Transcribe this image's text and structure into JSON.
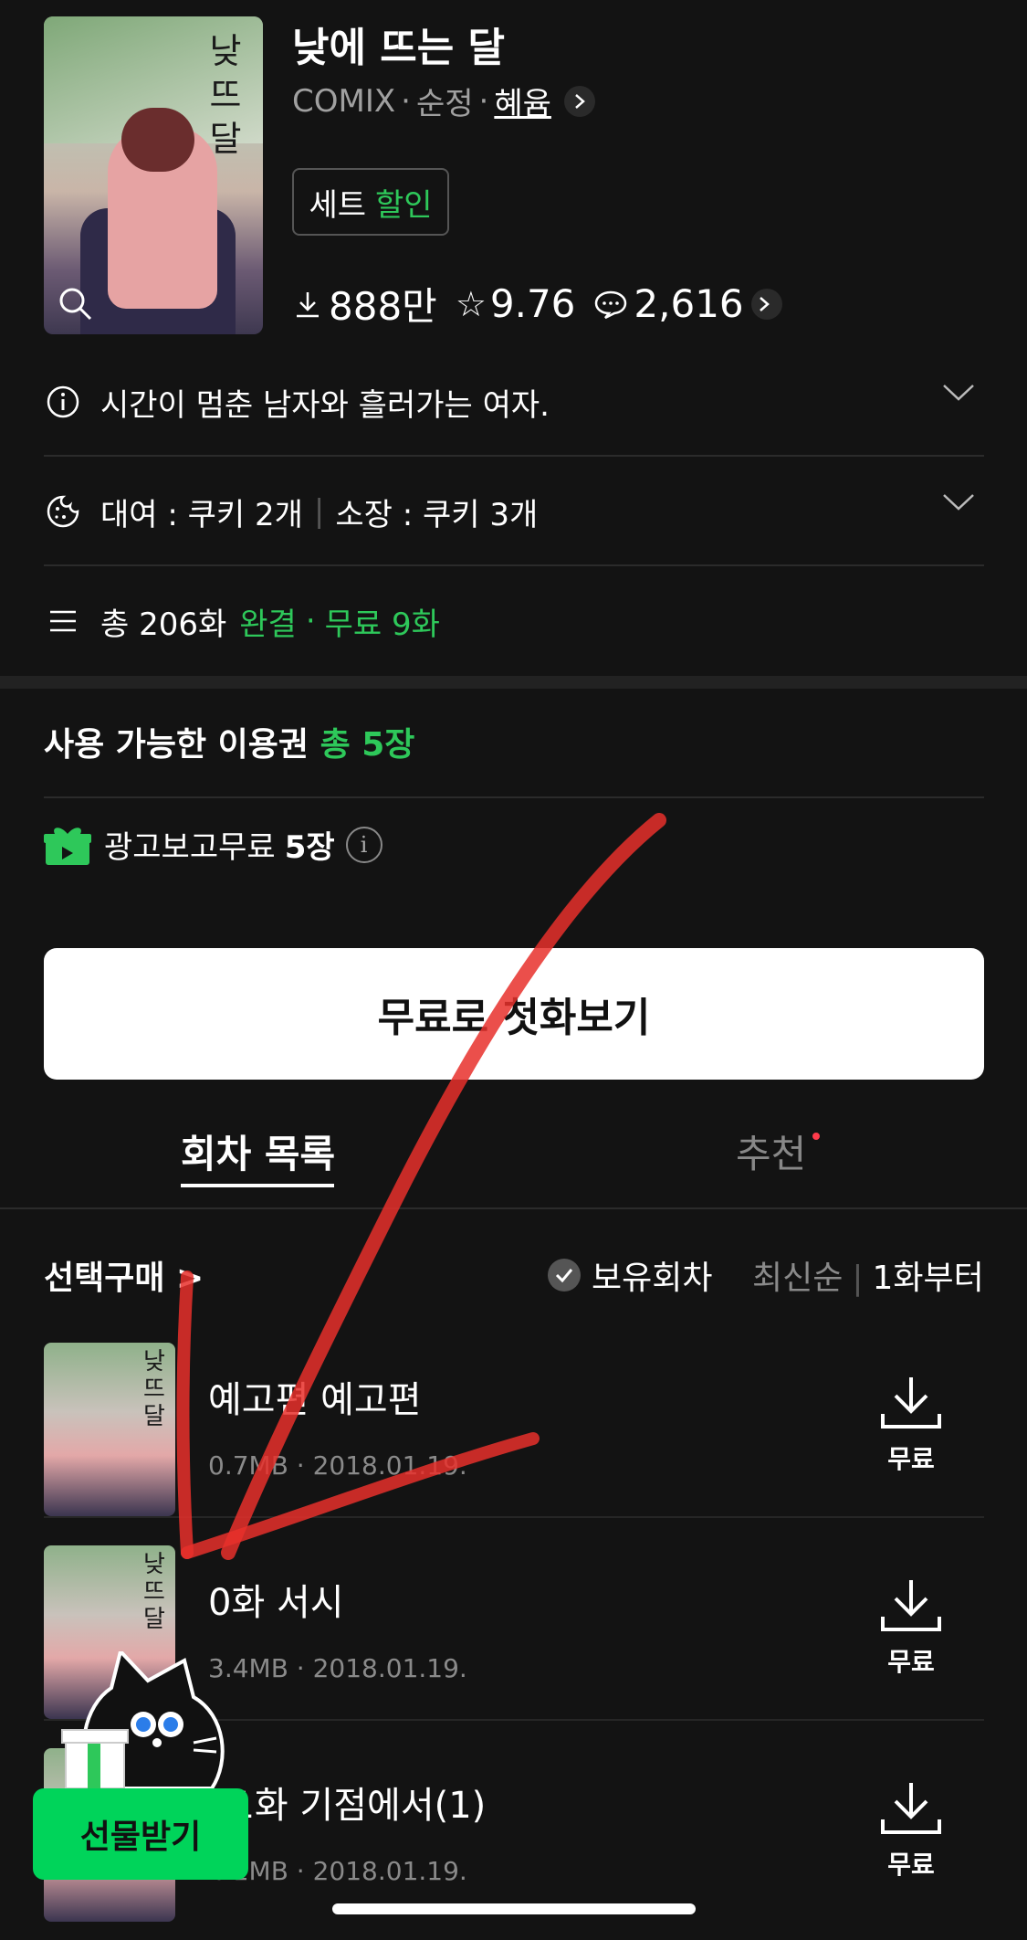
{
  "header": {
    "title": "낮에 뜨는 달",
    "publisher": "COMIX",
    "genre": "순정",
    "author": "혜윰",
    "set_label": "세트",
    "set_discount": "할인",
    "downloads": "888만",
    "rating": "9.76",
    "comments": "2,616",
    "cover_art_text": "낮에뜨는달"
  },
  "info": {
    "synopsis": "시간이 멈춘 남자와 흘러가는 여자.",
    "rent": "대여 : 쿠키 2개",
    "own": "소장 : 쿠키 3개",
    "total": "총 206화",
    "status": "완결",
    "free": "무료 9화",
    "dot": "·"
  },
  "tickets": {
    "title": "사용 가능한 이용권",
    "count": "총 5장",
    "ad_label": "광고보고무료",
    "ad_count": "5장"
  },
  "cta": {
    "free_first": "무료로 첫화보기"
  },
  "tabs": {
    "episodes": "회차 목록",
    "recommend": "추천"
  },
  "list_header": {
    "select_buy": "선택구매 >",
    "owned": "보유회차",
    "sort_latest": "최신순",
    "sort_first": "1화부터"
  },
  "episodes": [
    {
      "title": "예고편 예고편",
      "meta": "0.7MB · 2018.01.19.",
      "action": "무료"
    },
    {
      "title": "0화 서시",
      "meta": "3.4MB · 2018.01.19.",
      "action": "무료"
    },
    {
      "title": "01화 기점에서(1)",
      "meta": "4.1MB · 2018.01.19.",
      "action": "무료"
    }
  ],
  "gift": {
    "label": "선물받기"
  },
  "colors": {
    "accent": "#2ec85a",
    "background": "#131313",
    "gift": "#00d45a",
    "annotation": "#e8302c"
  }
}
